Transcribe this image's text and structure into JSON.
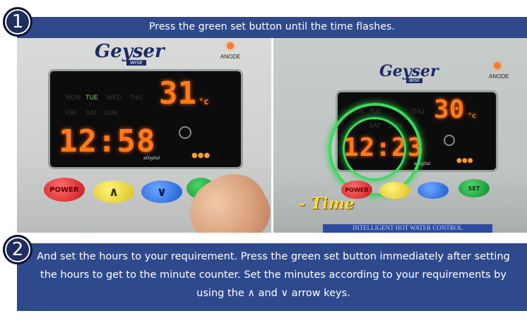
{
  "steps": [
    {
      "number": "1",
      "text": "Press the green set button until the time flashes."
    },
    {
      "number": "2",
      "text": "And set the hours to your requirement. Press the green set button immediately after setting the hours to get to the minute counter. Set the minutes according to your requirements by using the ∧ and ∨ arrow keys."
    }
  ],
  "photo_left": {
    "logo": "Geyser",
    "logo_sub": "WISE",
    "anode": "ANODE",
    "days_row1": [
      "MON",
      "TUE",
      "WED",
      "THU"
    ],
    "days_row2": [
      "FRI",
      "SAT",
      "SUN"
    ],
    "active_day": "TUE",
    "temp": "31",
    "temp_unit": "°c",
    "time": "12:58",
    "brand_small": "eDigital",
    "buttons": {
      "power": "POWER",
      "up": "∧",
      "down": "∨"
    }
  },
  "photo_right": {
    "logo": "Geyser",
    "logo_sub": "WISE",
    "anode": "ANODE",
    "days_row1": [
      "MON",
      "TUE",
      "THU"
    ],
    "days_row2": [
      "SAT",
      "SUN"
    ],
    "temp": "30",
    "temp_unit": "°c",
    "time": "12:23",
    "brand_small": "eDigital",
    "buttons": {
      "power": "POWER",
      "set": "SET"
    },
    "caption": "- Time",
    "strip": "INTELLIGENT HOT WATER CONTROL"
  },
  "colors": {
    "banner": "#2f4a8c",
    "green_ring": "#34e05a",
    "segment": "#ff7a1a"
  }
}
